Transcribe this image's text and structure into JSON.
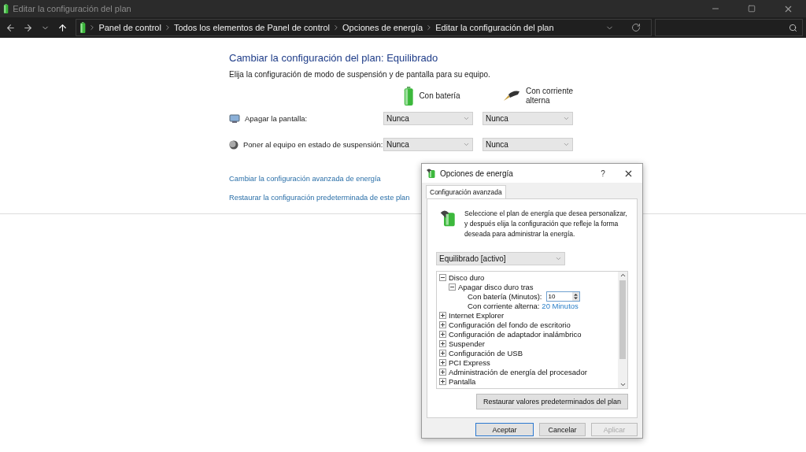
{
  "window": {
    "title": "Editar la configuración del plan"
  },
  "address_bar": {
    "breadcrumbs": [
      "Panel de control",
      "Todos los elementos de Panel de control",
      "Opciones de energía",
      "Editar la configuración del plan"
    ]
  },
  "page": {
    "title": "Cambiar la configuración del plan: Equilibrado",
    "description": "Elija la configuración de modo de suspensión y de pantalla para su equipo.",
    "columns": [
      {
        "kind": "battery",
        "label": "Con batería"
      },
      {
        "kind": "plug",
        "label": "Con corriente alterna"
      }
    ],
    "rows": [
      {
        "kind": "display",
        "label": "Apagar la pantalla:",
        "values": [
          "Nunca",
          "Nunca"
        ]
      },
      {
        "kind": "sleep",
        "label": "Poner al equipo en estado de suspensión:",
        "values": [
          "Nunca",
          "Nunca"
        ]
      }
    ],
    "links": [
      "Cambiar la configuración avanzada de energía",
      "Restaurar la configuración predeterminada de este plan"
    ]
  },
  "dialog": {
    "title": "Opciones de energía",
    "help": "?",
    "tabs": [
      {
        "label": "Configuración avanzada",
        "selected": true
      }
    ],
    "description": "Seleccione el plan de energía que desea personalizar, y después elija la configuración que refleje la forma deseada para administrar la energía.",
    "plan": "Equilibrado [activo]",
    "tree": [
      {
        "label": "Disco duro",
        "expanded": true,
        "children": [
          {
            "label": "Apagar disco duro tras",
            "expanded": true,
            "children": [
              {
                "kind": "spin",
                "label": "Con batería (Minutos):",
                "value": "10"
              },
              {
                "kind": "link",
                "label": "Con corriente alterna:",
                "value": "20 Minutos"
              }
            ]
          }
        ]
      },
      {
        "label": "Internet Explorer",
        "expanded": false
      },
      {
        "label": "Configuración del fondo de escritorio",
        "expanded": false
      },
      {
        "label": "Configuración de adaptador inalámbrico",
        "expanded": false
      },
      {
        "label": "Suspender",
        "expanded": false
      },
      {
        "label": "Configuración de USB",
        "expanded": false
      },
      {
        "label": "PCI Express",
        "expanded": false
      },
      {
        "label": "Administración de energía del procesador",
        "expanded": false
      },
      {
        "label": "Pantalla",
        "expanded": false
      }
    ],
    "restore_button": "Restaurar valores predeterminados del plan",
    "buttons": [
      {
        "label": "Aceptar",
        "default": true,
        "disabled": false
      },
      {
        "label": "Cancelar",
        "default": false,
        "disabled": false
      },
      {
        "label": "Aplicar",
        "default": false,
        "disabled": true
      }
    ]
  }
}
